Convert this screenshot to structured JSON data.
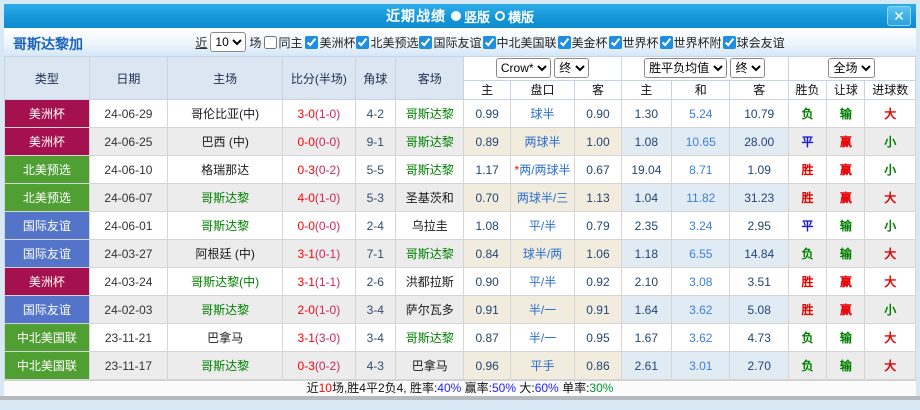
{
  "colors": {
    "titlebar_blue": "#1495d8",
    "league_maroon": "#a5114e",
    "league_green": "#4f9f33",
    "league_blue": "#5374c9",
    "fulltime_score_red": "#ff0000",
    "halftime_score_crimson": "#c62a5c",
    "team_green": "#008000",
    "odds_navy": "#234672",
    "odds_light_blue": "#3b80d8",
    "handicap_blue": "#2a6fce",
    "result_red": "#e60000",
    "result_green": "#008000",
    "result_blue": "#1717d6",
    "pct_blue": "#2222ff",
    "pct_green": "#009933"
  },
  "titlebar": {
    "title": "近期战绩",
    "view_options": [
      {
        "label": "竖版",
        "selected": true
      },
      {
        "label": "横版",
        "selected": false
      }
    ],
    "close_glyph": "✕"
  },
  "filterbar": {
    "team_name": "哥斯达黎加",
    "near_label": "近",
    "near_count": "10",
    "matches_label": "场",
    "same_home": {
      "label": "同主",
      "checked": false
    },
    "leagues": [
      {
        "label": "美洲杯",
        "checked": true
      },
      {
        "label": "北美预选",
        "checked": true
      },
      {
        "label": "国际友谊",
        "checked": true
      },
      {
        "label": "中北美国联",
        "checked": true
      },
      {
        "label": "美金杯",
        "checked": true
      },
      {
        "label": "世界杯",
        "checked": true
      },
      {
        "label": "世界杯附",
        "checked": true
      },
      {
        "label": "球会友谊",
        "checked": true
      }
    ]
  },
  "table": {
    "merged_headers": [
      "类型",
      "日期",
      "主场",
      "比分(半场)",
      "角球",
      "客场"
    ],
    "group_selects": {
      "crow": "Crow*",
      "crow_time": "终",
      "avg": "胜平负均值",
      "avg_time": "终",
      "scope": "全场"
    },
    "sub_headers": [
      "主",
      "盘口",
      "客",
      "主",
      "和",
      "客",
      "胜负",
      "让球",
      "进球数"
    ],
    "rows": [
      {
        "league": "美洲杯",
        "league_color": "maroon",
        "date": "24-06-29",
        "home": "哥伦比亚(中)",
        "home_green": false,
        "score": "3-0",
        "half": "(1-0)",
        "corner": "4-2",
        "away": "哥斯达黎",
        "away_green": true,
        "crow_home": "0.99",
        "handicap": "球半",
        "handicap_star": false,
        "crow_away": "0.90",
        "avg_home": "1.30",
        "avg_draw": "5.24",
        "avg_away": "10.79",
        "wdl": {
          "t": "负",
          "c": "green"
        },
        "let": {
          "t": "输",
          "c": "green"
        },
        "goals": {
          "t": "大",
          "c": "red"
        }
      },
      {
        "league": "美洲杯",
        "league_color": "maroon",
        "date": "24-06-25",
        "home": "巴西 (中)",
        "home_green": false,
        "score": "0-0",
        "half": "(0-0)",
        "corner": "9-1",
        "away": "哥斯达黎",
        "away_green": true,
        "crow_home": "0.89",
        "handicap": "两球半",
        "handicap_star": false,
        "crow_away": "1.00",
        "avg_home": "1.08",
        "avg_draw": "10.65",
        "avg_away": "28.00",
        "wdl": {
          "t": "平",
          "c": "blue"
        },
        "let": {
          "t": "赢",
          "c": "red"
        },
        "goals": {
          "t": "小",
          "c": "green"
        }
      },
      {
        "league": "北美预选",
        "league_color": "green",
        "date": "24-06-10",
        "home": "格瑞那达",
        "home_green": false,
        "score": "0-3",
        "half": "(0-2)",
        "corner": "5-5",
        "away": "哥斯达黎",
        "away_green": true,
        "crow_home": "1.17",
        "handicap": "两/两球半",
        "handicap_star": true,
        "crow_away": "0.67",
        "avg_home": "19.04",
        "avg_draw": "8.71",
        "avg_away": "1.09",
        "wdl": {
          "t": "胜",
          "c": "red"
        },
        "let": {
          "t": "赢",
          "c": "red"
        },
        "goals": {
          "t": "小",
          "c": "green"
        }
      },
      {
        "league": "北美预选",
        "league_color": "green",
        "date": "24-06-07",
        "home": "哥斯达黎",
        "home_green": true,
        "score": "4-0",
        "half": "(1-0)",
        "corner": "5-3",
        "away": "圣基茨和",
        "away_green": false,
        "crow_home": "0.70",
        "handicap": "两球半/三",
        "handicap_star": false,
        "crow_away": "1.13",
        "avg_home": "1.04",
        "avg_draw": "11.82",
        "avg_away": "31.23",
        "wdl": {
          "t": "胜",
          "c": "red"
        },
        "let": {
          "t": "赢",
          "c": "red"
        },
        "goals": {
          "t": "大",
          "c": "red"
        }
      },
      {
        "league": "国际友谊",
        "league_color": "blue",
        "date": "24-06-01",
        "home": "哥斯达黎",
        "home_green": true,
        "score": "0-0",
        "half": "(0-0)",
        "corner": "2-4",
        "away": "乌拉圭",
        "away_green": false,
        "crow_home": "1.08",
        "handicap": "平/半",
        "handicap_star": false,
        "crow_away": "0.79",
        "avg_home": "2.35",
        "avg_draw": "3.24",
        "avg_away": "2.95",
        "wdl": {
          "t": "平",
          "c": "blue"
        },
        "let": {
          "t": "输",
          "c": "green"
        },
        "goals": {
          "t": "小",
          "c": "green"
        }
      },
      {
        "league": "国际友谊",
        "league_color": "blue",
        "date": "24-03-27",
        "home": "阿根廷 (中)",
        "home_green": false,
        "score": "3-1",
        "half": "(0-1)",
        "corner": "7-1",
        "away": "哥斯达黎",
        "away_green": true,
        "crow_home": "0.84",
        "handicap": "球半/两",
        "handicap_star": false,
        "crow_away": "1.06",
        "avg_home": "1.18",
        "avg_draw": "6.55",
        "avg_away": "14.84",
        "wdl": {
          "t": "负",
          "c": "green"
        },
        "let": {
          "t": "输",
          "c": "green"
        },
        "goals": {
          "t": "大",
          "c": "red"
        }
      },
      {
        "league": "美洲杯",
        "league_color": "maroon",
        "date": "24-03-24",
        "home": "哥斯达黎(中)",
        "home_green": true,
        "score": "3-1",
        "half": "(1-1)",
        "corner": "2-6",
        "away": "洪都拉斯",
        "away_green": false,
        "crow_home": "0.90",
        "handicap": "平/半",
        "handicap_star": false,
        "crow_away": "0.92",
        "avg_home": "2.10",
        "avg_draw": "3.08",
        "avg_away": "3.51",
        "wdl": {
          "t": "胜",
          "c": "red"
        },
        "let": {
          "t": "赢",
          "c": "red"
        },
        "goals": {
          "t": "大",
          "c": "red"
        }
      },
      {
        "league": "国际友谊",
        "league_color": "blue",
        "date": "24-02-03",
        "home": "哥斯达黎",
        "home_green": true,
        "score": "2-0",
        "half": "(1-0)",
        "corner": "3-4",
        "away": "萨尔瓦多",
        "away_green": false,
        "crow_home": "0.91",
        "handicap": "半/一",
        "handicap_star": false,
        "crow_away": "0.91",
        "avg_home": "1.64",
        "avg_draw": "3.62",
        "avg_away": "5.08",
        "wdl": {
          "t": "胜",
          "c": "red"
        },
        "let": {
          "t": "赢",
          "c": "red"
        },
        "goals": {
          "t": "小",
          "c": "green"
        }
      },
      {
        "league": "中北美国联",
        "league_color": "green",
        "date": "23-11-21",
        "home": "巴拿马",
        "home_green": false,
        "score": "3-1",
        "half": "(3-0)",
        "corner": "3-4",
        "away": "哥斯达黎",
        "away_green": true,
        "crow_home": "0.87",
        "handicap": "半/一",
        "handicap_star": false,
        "crow_away": "0.95",
        "avg_home": "1.67",
        "avg_draw": "3.62",
        "avg_away": "4.73",
        "wdl": {
          "t": "负",
          "c": "green"
        },
        "let": {
          "t": "输",
          "c": "green"
        },
        "goals": {
          "t": "大",
          "c": "red"
        }
      },
      {
        "league": "中北美国联",
        "league_color": "green",
        "date": "23-11-17",
        "home": "哥斯达黎",
        "home_green": true,
        "score": "0-3",
        "half": "(0-2)",
        "corner": "4-3",
        "away": "巴拿马",
        "away_green": false,
        "crow_home": "0.96",
        "handicap": "平手",
        "handicap_star": false,
        "crow_away": "0.86",
        "avg_home": "2.61",
        "avg_draw": "3.01",
        "avg_away": "2.70",
        "wdl": {
          "t": "负",
          "c": "green"
        },
        "let": {
          "t": "输",
          "c": "green"
        },
        "goals": {
          "t": "大",
          "c": "red"
        }
      }
    ]
  },
  "footer": {
    "segments": [
      {
        "t": "近",
        "c": "black"
      },
      {
        "t": "10",
        "c": "red"
      },
      {
        "t": "场,胜4平2负4, 胜率:",
        "c": "black"
      },
      {
        "t": "40%",
        "c": "blue"
      },
      {
        "t": " 赢率:",
        "c": "black"
      },
      {
        "t": "50%",
        "c": "blue"
      },
      {
        "t": " 大:",
        "c": "black"
      },
      {
        "t": "60%",
        "c": "blue"
      },
      {
        "t": " 单率:",
        "c": "black"
      },
      {
        "t": "30%",
        "c": "green"
      }
    ]
  }
}
